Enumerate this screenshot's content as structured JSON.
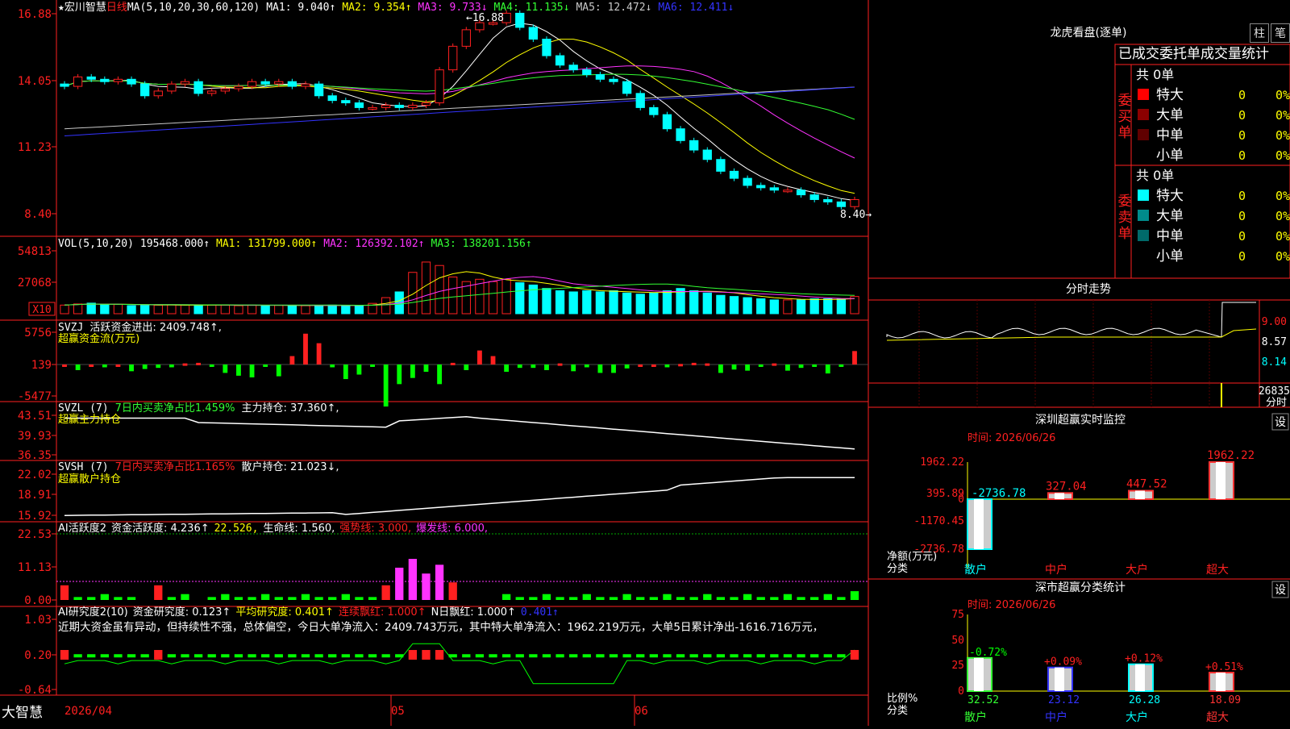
{
  "stock": {
    "name": "宏川智慧",
    "period": "日线",
    "star": "★",
    "app_name": "大智慧"
  },
  "indicators": {
    "ma": {
      "label": "MA(5,10,20,30,60,120)",
      "items": [
        {
          "text": "MA1: 9.040↑",
          "color": "#ffffff"
        },
        {
          "text": "MA2: 9.354↑",
          "color": "#ffff00"
        },
        {
          "text": "MA3: 9.733↓",
          "color": "#ff33ff"
        },
        {
          "text": "MA4: 11.135↓",
          "color": "#33ff33"
        },
        {
          "text": "MA5: 12.472↓",
          "color": "#c8c8c8"
        },
        {
          "text": "MA6: 12.411↓",
          "color": "#3333ff"
        }
      ]
    },
    "vol": {
      "label": "VOL(5,10,20)",
      "value": "195468.000↑",
      "items": [
        {
          "text": "MA1: 131799.000↑",
          "color": "#ffff00"
        },
        {
          "text": "MA2: 126392.102↑",
          "color": "#ff33ff"
        },
        {
          "text": "MA3: 138201.156↑",
          "color": "#33ff33"
        }
      ],
      "unit": "X10"
    },
    "svzj": {
      "label": "SVZJ",
      "text": "活跃资金进出: 2409.748↑,",
      "sub": "超赢资金流(万元)"
    },
    "svzl": {
      "label": "SVZL (7)",
      "text1": "7日内买卖净占比1.459%",
      "text2": "主力持仓: 37.360↑,",
      "sub": "超赢主力持仓"
    },
    "svsh": {
      "label": "SVSH (7)",
      "text1": "7日内买卖净占比1.165%",
      "text2": "散户持仓: 21.023↓,",
      "sub": "超赢散户持仓"
    },
    "ai2": {
      "label": "AI活跃度2",
      "text1": "资金活跃度: 4.236↑",
      "text2": "22.526,",
      "text3": "生命线: 1.560,",
      "text4": "强势线: 3.000,",
      "text5": "爆发线: 6.000,"
    },
    "ai_research": {
      "label": "AI研究度2(10)",
      "text1": "资金研究度: 0.123↑",
      "text2": "平均研究度: 0.401↑",
      "text3": "连续飘红: 1.000↑",
      "text4": "N日飘红: 1.000↑",
      "text5": "0.401↑",
      "comment": "近期大资金虽有异动，但持续性不强，总体偏空，今日大单净流入：2409.743万元，其中特大单净流入：1962.219万元，大单5日累计净出-1616.716万元，"
    }
  },
  "axes": {
    "price": [
      "16.88",
      "14.05",
      "11.23",
      "8.40"
    ],
    "vol": [
      "54813",
      "27068"
    ],
    "svzj": [
      "5756",
      "139",
      "-5477"
    ],
    "svzl": [
      "43.51",
      "39.93",
      "36.35"
    ],
    "svsh": [
      "22.02",
      "18.91",
      "15.92"
    ],
    "ai2": [
      "22.53",
      "11.13",
      "0.00"
    ],
    "air": [
      "1.03",
      "0.20",
      "-0.64"
    ],
    "dates": [
      "2026/04",
      "05",
      "06"
    ]
  },
  "annotations": {
    "high": "←16.88",
    "low": "8.40→"
  },
  "right": {
    "lhb_title": "龙虎看盘(逐单)",
    "btn_bar": "柱",
    "btn_line": "笔",
    "tabs_text": "已成交委托单成交量统计",
    "buy": {
      "label": "委买单",
      "total": "共 0单",
      "rows": [
        {
          "name": "特大",
          "count": "0",
          "pct": "0%",
          "color": "#ff0000"
        },
        {
          "name": "大单",
          "count": "0",
          "pct": "0%",
          "color": "#8b0000"
        },
        {
          "name": "中单",
          "count": "0",
          "pct": "0%",
          "color": "#600000"
        },
        {
          "name": "小单",
          "count": "0",
          "pct": "0%",
          "color": "#000000"
        }
      ]
    },
    "sell": {
      "label": "委卖单",
      "total": "共 0单",
      "rows": [
        {
          "name": "特大",
          "count": "0",
          "pct": "0%",
          "color": "#00ffff"
        },
        {
          "name": "大单",
          "count": "0",
          "pct": "0%",
          "color": "#008b8b"
        },
        {
          "name": "中单",
          "count": "0",
          "pct": "0%",
          "color": "#006a6a"
        },
        {
          "name": "小单",
          "count": "0",
          "pct": "0%",
          "color": "#000000"
        }
      ]
    },
    "intraday": {
      "title": "分时走势",
      "prices": [
        "9.00",
        "8.57",
        "8.14"
      ],
      "vol": "26835",
      "vol_label": "分时"
    },
    "monitor": {
      "title": "深圳超赢实时监控",
      "btn": "设",
      "time": "时间: 2026/06/26",
      "yaxis": [
        "1962.22",
        "395.89",
        "0",
        "-1170.45",
        "-2736.78"
      ],
      "ylabel": "净额(万元)",
      "xlabel": "分类",
      "bars": [
        {
          "cat": "散户",
          "value": -2736.78,
          "label": "-2736.78",
          "color": "#00ffff"
        },
        {
          "cat": "中户",
          "value": 327.04,
          "label": "327.04",
          "color": "#ff3333"
        },
        {
          "cat": "大户",
          "value": 447.52,
          "label": "447.52",
          "color": "#ff3333"
        },
        {
          "cat": "超大",
          "value": 1962.22,
          "label": "1962.22",
          "color": "#ff3333"
        }
      ]
    },
    "classify": {
      "title": "深市超赢分类统计",
      "btn": "设",
      "time": "时间: 2026/06/26",
      "yaxis": [
        "75",
        "50",
        "25",
        "0"
      ],
      "ylabel": "比例%",
      "xlabel": "分类",
      "bars": [
        {
          "cat": "散户",
          "value": 32.52,
          "change": "-0.72%",
          "color": "#33ff33",
          "cat_color": "#33ff33"
        },
        {
          "cat": "中户",
          "value": 23.12,
          "change": "+0.09%",
          "color": "#3333ff",
          "cat_color": "#3333ff"
        },
        {
          "cat": "大户",
          "value": 26.28,
          "change": "+0.12%",
          "color": "#00ffff",
          "cat_color": "#00ffff"
        },
        {
          "cat": "超大",
          "value": 18.09,
          "change": "+0.51%",
          "color": "#ff3333",
          "cat_color": "#ff3333"
        }
      ]
    }
  },
  "chart_data": {
    "type": "candlestick",
    "count": 60,
    "closes": [
      13.8,
      14.2,
      14.1,
      14.0,
      14.1,
      13.9,
      13.4,
      13.6,
      13.9,
      14.0,
      13.5,
      13.6,
      13.7,
      13.8,
      14.0,
      13.9,
      14.0,
      13.8,
      13.9,
      13.4,
      13.2,
      13.1,
      12.9,
      12.9,
      13.0,
      12.9,
      13.0,
      13.1,
      14.5,
      15.5,
      16.2,
      16.5,
      16.5,
      16.9,
      16.3,
      15.8,
      15.1,
      14.7,
      14.5,
      14.3,
      14.1,
      14.0,
      13.5,
      12.9,
      12.6,
      12.0,
      11.5,
      11.1,
      10.7,
      10.2,
      9.9,
      9.6,
      9.5,
      9.4,
      9.4,
      9.2,
      9.0,
      8.9,
      8.7,
      9.0
    ],
    "vol_values": [
      7.5,
      8.5,
      9.2,
      7.8,
      8.1,
      7.0,
      7.3,
      7.4,
      7.8,
      7.5,
      7.2,
      7.5,
      7.5,
      7.0,
      7.5,
      7.1,
      7.3,
      7.2,
      7.0,
      7.0,
      7.5,
      7.2,
      7.1,
      9.0,
      14,
      19,
      36,
      45,
      42,
      32,
      28,
      30,
      28,
      30,
      27,
      25,
      22,
      20,
      19,
      20,
      19,
      20,
      18,
      17,
      18,
      20,
      22,
      20,
      18,
      16,
      15,
      14,
      13,
      12,
      12,
      12,
      13,
      13,
      13,
      15
    ],
    "svzj_values": [
      0,
      -1,
      0,
      -0.5,
      0,
      -1.2,
      -0.8,
      -0.6,
      -0.5,
      0.2,
      0.3,
      -0.2,
      -1.5,
      -2,
      -2.3,
      -0.3,
      -2.1,
      1.5,
      5.5,
      3.8,
      -0.5,
      -2.6,
      -1.8,
      -0.2,
      -7.5,
      -3.5,
      -2.4,
      -1.3,
      -3.5,
      0.3,
      -1,
      2.5,
      1.5,
      -1.3,
      -0.6,
      -0.6,
      -1,
      0.2,
      -1.2,
      -0.5,
      -1.5,
      -1.5,
      -0.7,
      0,
      0,
      -0.5,
      0.1,
      0.3,
      0.2,
      -1.5,
      -0.9,
      -1.1,
      -0.3,
      0.2,
      -1.1,
      -0.6,
      -0.3,
      -1.6,
      -0.4,
      2.4
    ]
  }
}
